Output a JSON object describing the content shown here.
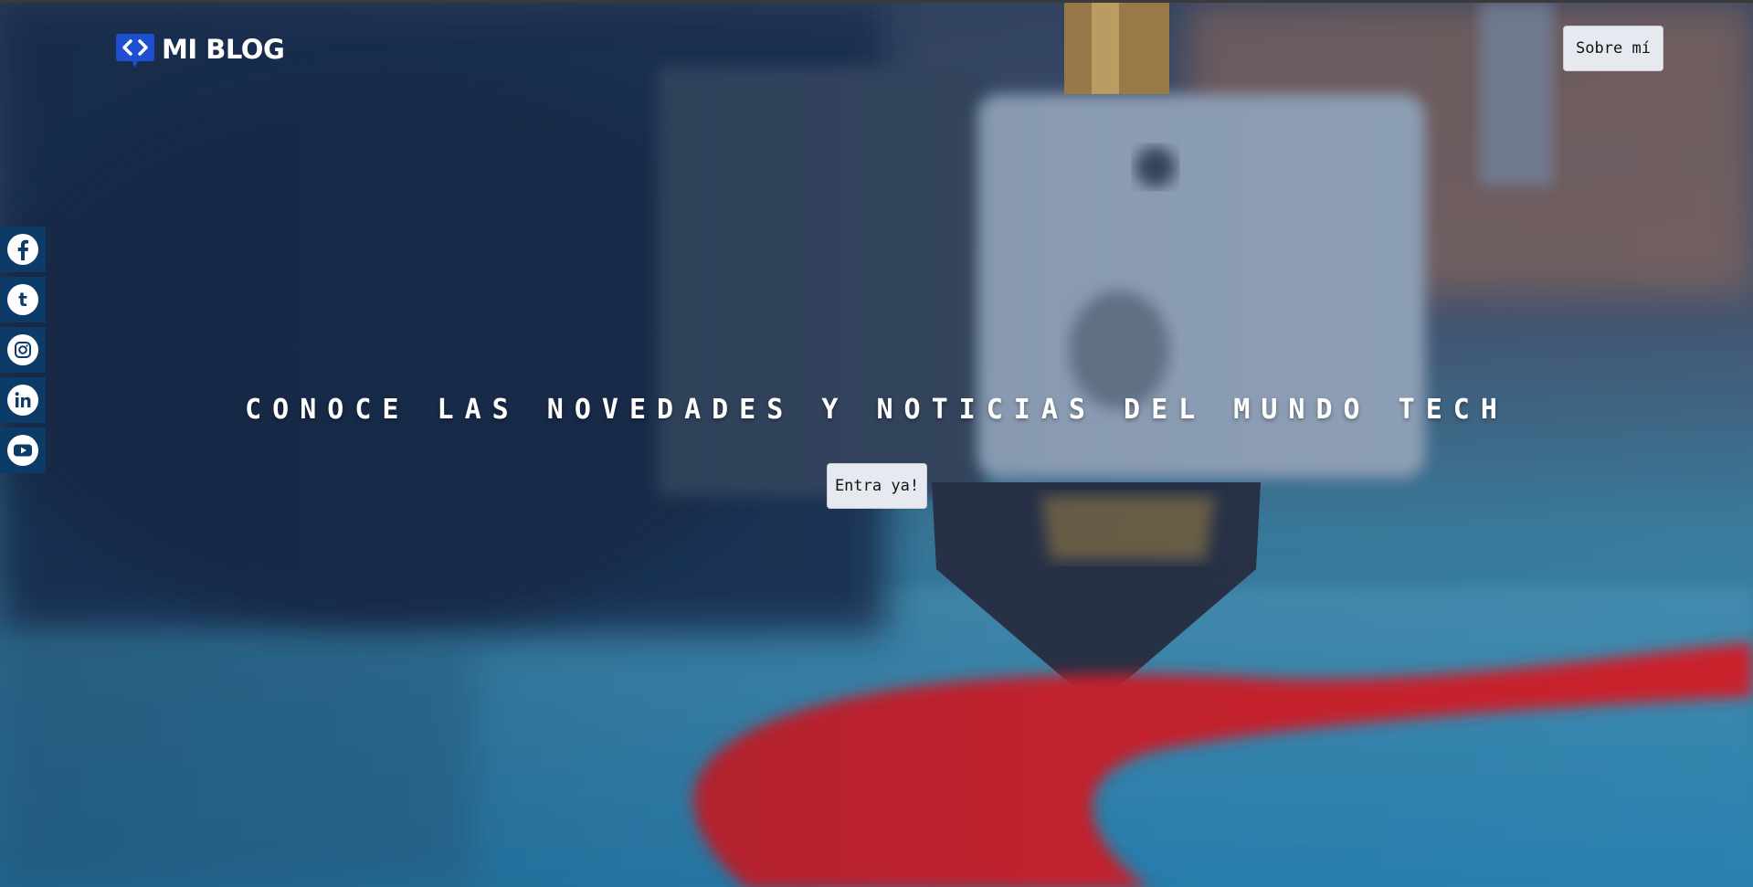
{
  "header": {
    "logo_text": "MI BLOG",
    "about_label": "Sobre mí"
  },
  "social": [
    {
      "icon": "facebook-icon"
    },
    {
      "icon": "tumblr-icon"
    },
    {
      "icon": "instagram-icon"
    },
    {
      "icon": "linkedin-icon"
    },
    {
      "icon": "youtube-icon"
    }
  ],
  "hero": {
    "headline": "CONOCE LAS NOVEDADES Y NOTICIAS DEL MUNDO TECH",
    "cta_label": "Entra ya!"
  },
  "colors": {
    "social_bg": "#0c3b68",
    "logo_accent": "#1f4fd1",
    "button_bg": "#e6e9ef"
  }
}
